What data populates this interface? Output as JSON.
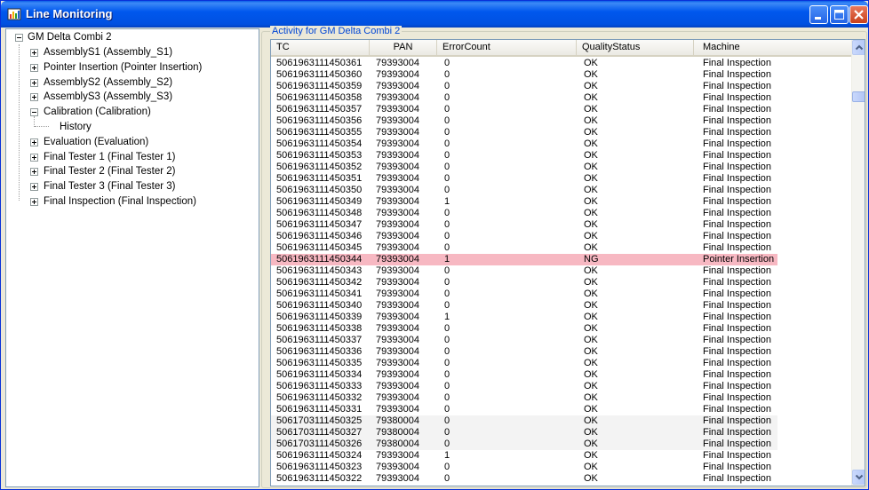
{
  "window": {
    "title": "Line Monitoring",
    "icon": "app-chart-icon",
    "controls": [
      "minimize-icon",
      "maximize-icon",
      "close-icon"
    ]
  },
  "tree": {
    "root": {
      "label": "GM Delta Combi 2",
      "expanded": true
    },
    "items": [
      {
        "label": "AssemblyS1 (Assembly_S1)",
        "expanded": false
      },
      {
        "label": "Pointer Insertion (Pointer Insertion)",
        "expanded": false
      },
      {
        "label": "AssemblyS2 (Assembly_S2)",
        "expanded": false
      },
      {
        "label": "AssemblyS3 (Assembly_S3)",
        "expanded": false
      },
      {
        "label": "Calibration (Calibration)",
        "expanded": true,
        "children": [
          {
            "label": "History"
          }
        ]
      },
      {
        "label": "Evaluation (Evaluation)",
        "expanded": false
      },
      {
        "label": "Final Tester 1 (Final Tester 1)",
        "expanded": false
      },
      {
        "label": "Final Tester 2 (Final Tester 2)",
        "expanded": false
      },
      {
        "label": "Final Tester 3 (Final Tester 3)",
        "expanded": false
      },
      {
        "label": "Final Inspection (Final Inspection)",
        "expanded": false
      }
    ]
  },
  "activity": {
    "group_title": "Activity for GM Delta Combi 2",
    "columns": [
      "TC",
      "PAN",
      "ErrorCount",
      "QualityStatus",
      "Machine"
    ],
    "rows": [
      [
        "5061963111450361",
        "79393004",
        "0",
        "OK",
        "Final Inspection"
      ],
      [
        "5061963111450360",
        "79393004",
        "0",
        "OK",
        "Final Inspection"
      ],
      [
        "5061963111450359",
        "79393004",
        "0",
        "OK",
        "Final Inspection"
      ],
      [
        "5061963111450358",
        "79393004",
        "0",
        "OK",
        "Final Inspection"
      ],
      [
        "5061963111450357",
        "79393004",
        "0",
        "OK",
        "Final Inspection"
      ],
      [
        "5061963111450356",
        "79393004",
        "0",
        "OK",
        "Final Inspection"
      ],
      [
        "5061963111450355",
        "79393004",
        "0",
        "OK",
        "Final Inspection"
      ],
      [
        "5061963111450354",
        "79393004",
        "0",
        "OK",
        "Final Inspection"
      ],
      [
        "5061963111450353",
        "79393004",
        "0",
        "OK",
        "Final Inspection"
      ],
      [
        "5061963111450352",
        "79393004",
        "0",
        "OK",
        "Final Inspection"
      ],
      [
        "5061963111450351",
        "79393004",
        "0",
        "OK",
        "Final Inspection"
      ],
      [
        "5061963111450350",
        "79393004",
        "0",
        "OK",
        "Final Inspection"
      ],
      [
        "5061963111450349",
        "79393004",
        "1",
        "OK",
        "Final Inspection"
      ],
      [
        "5061963111450348",
        "79393004",
        "0",
        "OK",
        "Final Inspection"
      ],
      [
        "5061963111450347",
        "79393004",
        "0",
        "OK",
        "Final Inspection"
      ],
      [
        "5061963111450346",
        "79393004",
        "0",
        "OK",
        "Final Inspection"
      ],
      [
        "5061963111450345",
        "79393004",
        "0",
        "OK",
        "Final Inspection"
      ],
      [
        "5061963111450344",
        "79393004",
        "1",
        "NG",
        "Pointer Insertion"
      ],
      [
        "5061963111450343",
        "79393004",
        "0",
        "OK",
        "Final Inspection"
      ],
      [
        "5061963111450342",
        "79393004",
        "0",
        "OK",
        "Final Inspection"
      ],
      [
        "5061963111450341",
        "79393004",
        "0",
        "OK",
        "Final Inspection"
      ],
      [
        "5061963111450340",
        "79393004",
        "0",
        "OK",
        "Final Inspection"
      ],
      [
        "5061963111450339",
        "79393004",
        "1",
        "OK",
        "Final Inspection"
      ],
      [
        "5061963111450338",
        "79393004",
        "0",
        "OK",
        "Final Inspection"
      ],
      [
        "5061963111450337",
        "79393004",
        "0",
        "OK",
        "Final Inspection"
      ],
      [
        "5061963111450336",
        "79393004",
        "0",
        "OK",
        "Final Inspection"
      ],
      [
        "5061963111450335",
        "79393004",
        "0",
        "OK",
        "Final Inspection"
      ],
      [
        "5061963111450334",
        "79393004",
        "0",
        "OK",
        "Final Inspection"
      ],
      [
        "5061963111450333",
        "79393004",
        "0",
        "OK",
        "Final Inspection"
      ],
      [
        "5061963111450332",
        "79393004",
        "0",
        "OK",
        "Final Inspection"
      ],
      [
        "5061963111450331",
        "79393004",
        "0",
        "OK",
        "Final Inspection"
      ],
      [
        "5061703111450325",
        "79380004",
        "0",
        "OK",
        "Final Inspection"
      ],
      [
        "5061703111450327",
        "79380004",
        "0",
        "OK",
        "Final Inspection"
      ],
      [
        "5061703111450326",
        "79380004",
        "0",
        "OK",
        "Final Inspection"
      ],
      [
        "5061963111450324",
        "79393004",
        "1",
        "OK",
        "Final Inspection"
      ],
      [
        "5061963111450323",
        "79393004",
        "0",
        "OK",
        "Final Inspection"
      ],
      [
        "5061963111450322",
        "79393004",
        "0",
        "OK",
        "Final Inspection"
      ]
    ],
    "error_row_color": "#f7b8c2",
    "alt_row_color": "#f3f3f3"
  }
}
